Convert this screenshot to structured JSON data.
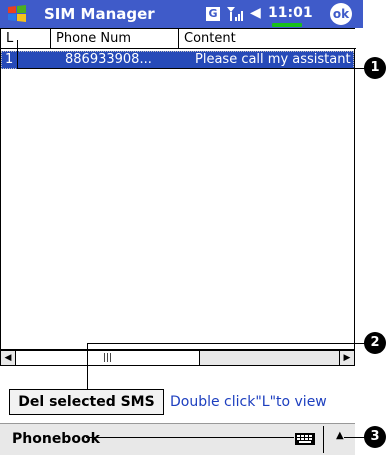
{
  "titlebar": {
    "app_title": "SIM Manager",
    "network_badge": "G",
    "clock": "11:01",
    "ok_label": "ok",
    "icons": [
      "windows-flag-icon",
      "network-g-icon",
      "signal-icon",
      "speaker-icon",
      "battery-icon",
      "ok-icon"
    ]
  },
  "list": {
    "columns": [
      "L",
      "Phone Num",
      "Content"
    ],
    "rows": [
      {
        "l": "1",
        "phone": "886933908...",
        "content": "Please call my assistant"
      }
    ],
    "selected_row": 0
  },
  "actions": {
    "delete_label": "Del selected SMS",
    "hint": "Double click\"L\"to view"
  },
  "menubar": {
    "left_label": "Phonebook"
  },
  "callouts": [
    "1",
    "2",
    "3"
  ],
  "colors": {
    "titlebar_bg": "#3f5bc9",
    "selection_bg": "#264ab8",
    "hint_text": "#1d3fbf",
    "battery": "#18c018"
  }
}
